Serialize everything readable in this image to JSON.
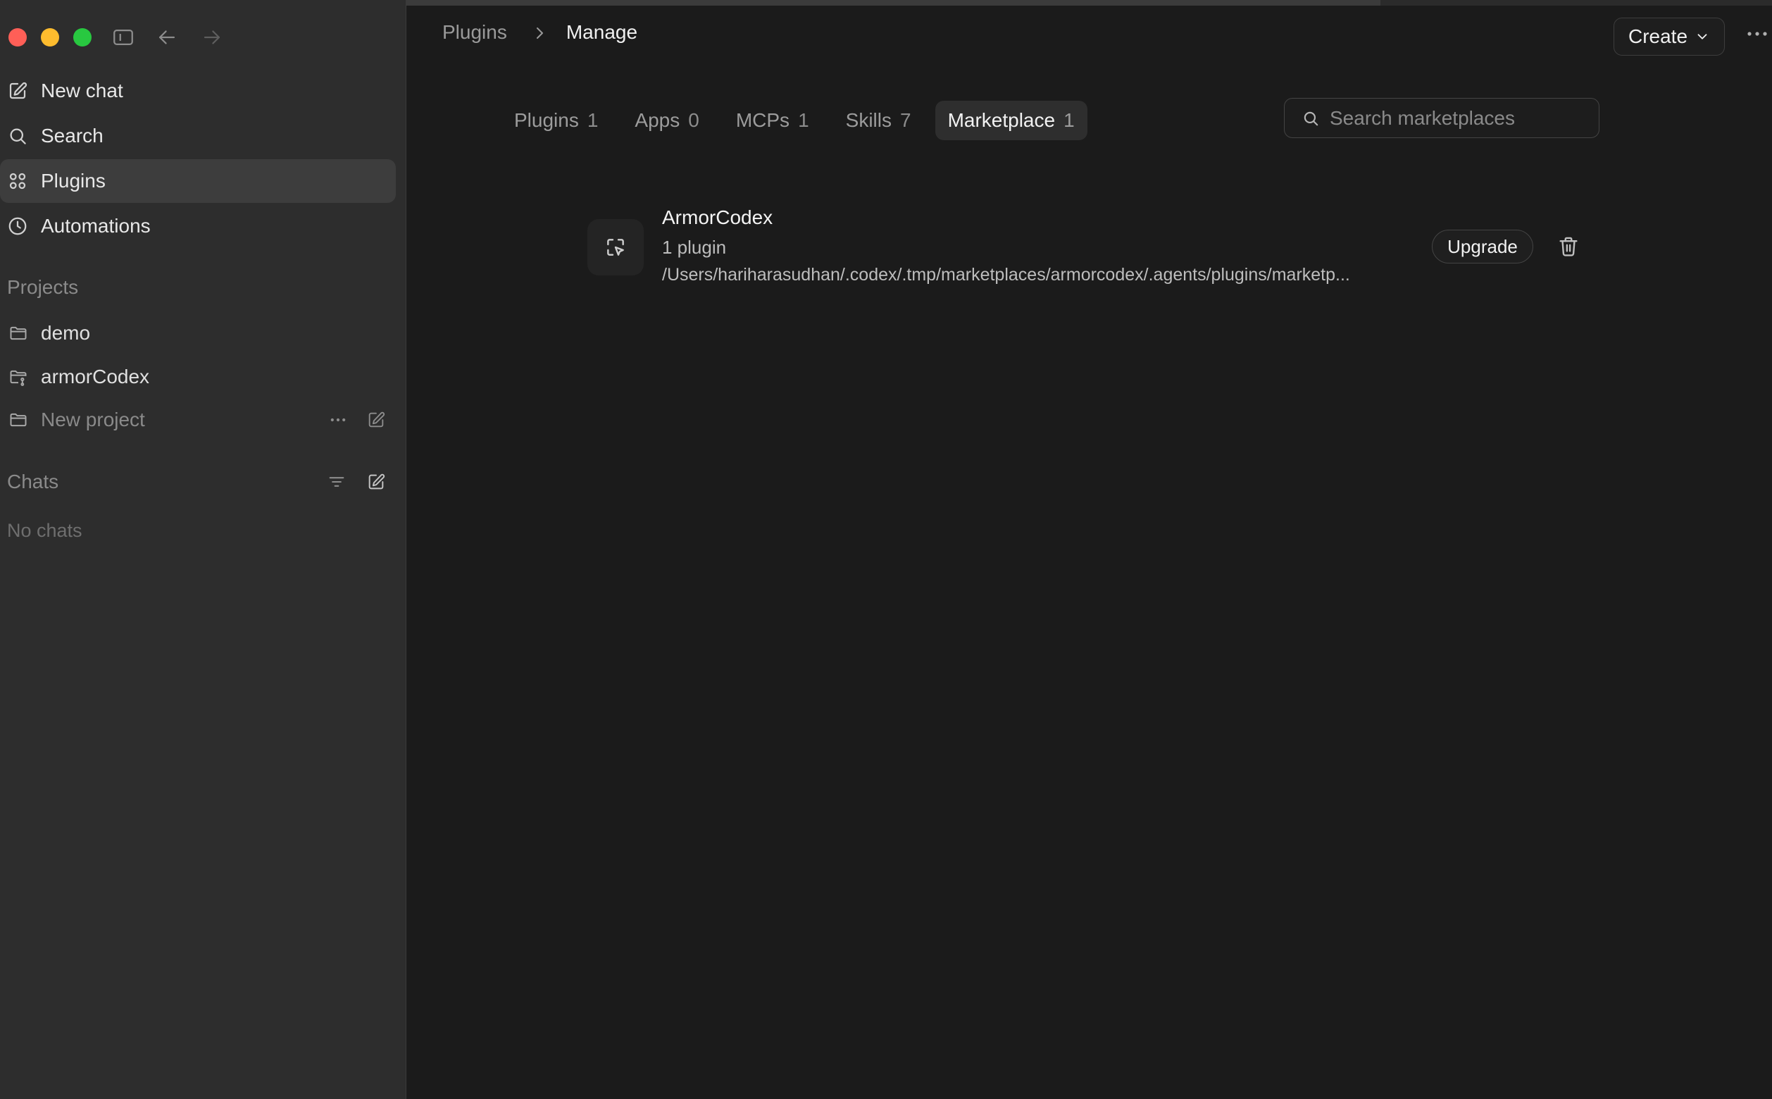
{
  "sidebar": {
    "nav": [
      {
        "label": "New chat",
        "icon": "compose-icon"
      },
      {
        "label": "Search",
        "icon": "search-icon"
      },
      {
        "label": "Plugins",
        "icon": "grid-icon",
        "active": true
      },
      {
        "label": "Automations",
        "icon": "clock-icon"
      }
    ],
    "projects_heading": "Projects",
    "projects": [
      {
        "label": "demo",
        "icon": "folder-icon"
      },
      {
        "label": "armorCodex",
        "icon": "folder-git-icon"
      },
      {
        "label": "New project",
        "icon": "folder-icon"
      }
    ],
    "chats_heading": "Chats",
    "no_chats": "No chats"
  },
  "header": {
    "breadcrumb_parent": "Plugins",
    "breadcrumb_current": "Manage",
    "create_label": "Create"
  },
  "tabs": [
    {
      "label": "Plugins",
      "count": "1"
    },
    {
      "label": "Apps",
      "count": "0"
    },
    {
      "label": "MCPs",
      "count": "1"
    },
    {
      "label": "Skills",
      "count": "7"
    },
    {
      "label": "Marketplace",
      "count": "1",
      "active": true
    }
  ],
  "search": {
    "placeholder": "Search marketplaces"
  },
  "marketplaces": [
    {
      "name": "ArmorCodex",
      "count": "1 plugin",
      "path": "/Users/hariharasudhan/.codex/.tmp/marketplaces/armorcodex/.agents/plugins/marketp...",
      "action": "Upgrade"
    }
  ],
  "colors": {
    "sidebar_bg": "#2d2d2d",
    "main_bg": "#1b1b1b",
    "close": "#ff5f57",
    "minimize": "#febc2e",
    "zoom": "#28c840"
  }
}
